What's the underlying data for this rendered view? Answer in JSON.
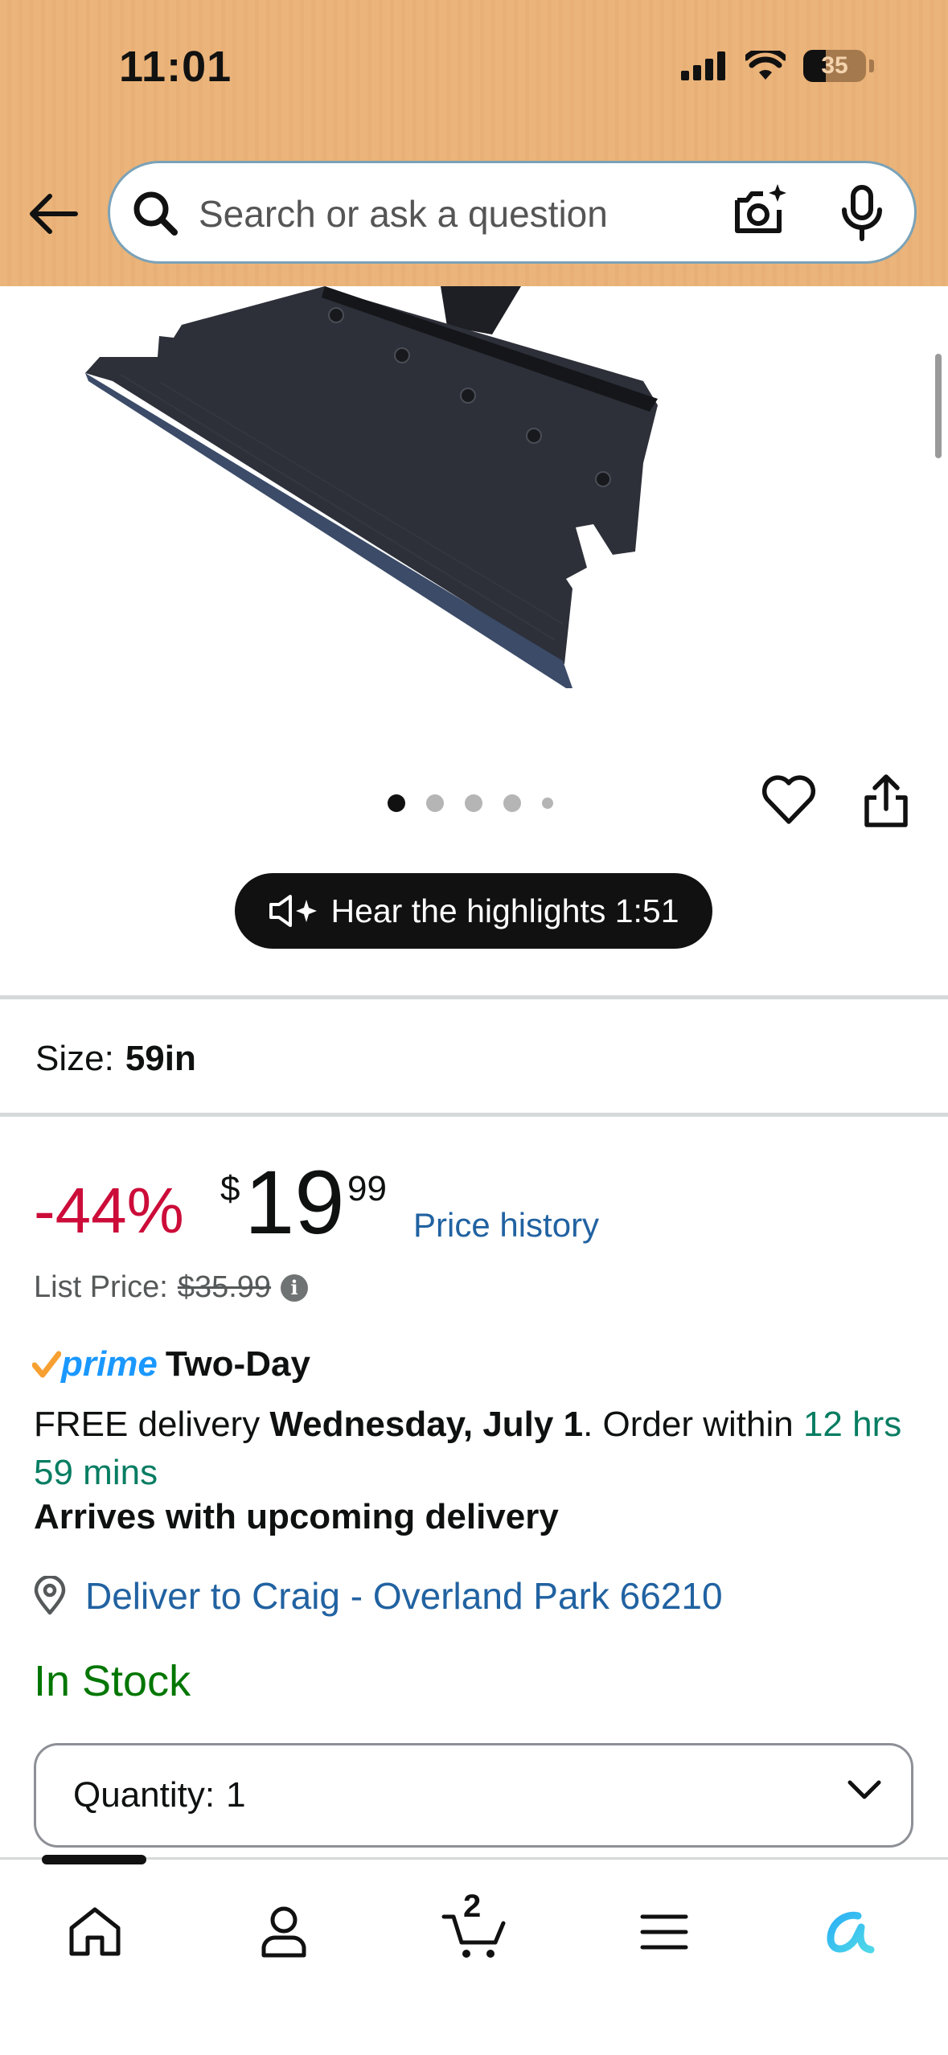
{
  "status_bar": {
    "time": "11:01",
    "battery": "35"
  },
  "search": {
    "placeholder": "Search or ask a question"
  },
  "product_image": {
    "alt": "Snow shovel blade"
  },
  "carousel": {
    "count": 5,
    "active_index": 0
  },
  "highlights": {
    "label": "Hear the highlights 1:51"
  },
  "size": {
    "label": "Size:",
    "value": "59in"
  },
  "price": {
    "discount": "-44%",
    "currency": "$",
    "whole": "19",
    "fraction": "99",
    "history_link": "Price history",
    "list_label": "List Price:",
    "list_value": "$35.99"
  },
  "prime": {
    "word": "prime",
    "speed": "Two-Day"
  },
  "delivery": {
    "prefix": "FREE delivery ",
    "date": "Wednesday, July 1",
    "middle": ". Order within ",
    "countdown": "12 hrs 59 mins",
    "arrives": "Arrives with upcoming delivery",
    "deliver_to": "Deliver to Craig - Overland Park 66210"
  },
  "stock": {
    "status": "In Stock"
  },
  "quantity": {
    "label": "Quantity:",
    "value": "1"
  },
  "cart": {
    "count": "2"
  },
  "colors": {
    "header_bg": "#ebb47a",
    "discount_red": "#cc0c39",
    "link_blue": "#2162a1",
    "stock_green": "#007600",
    "countdown_green": "#067d62",
    "prime_blue": "#1a98ff",
    "prime_check": "#f7a032"
  }
}
